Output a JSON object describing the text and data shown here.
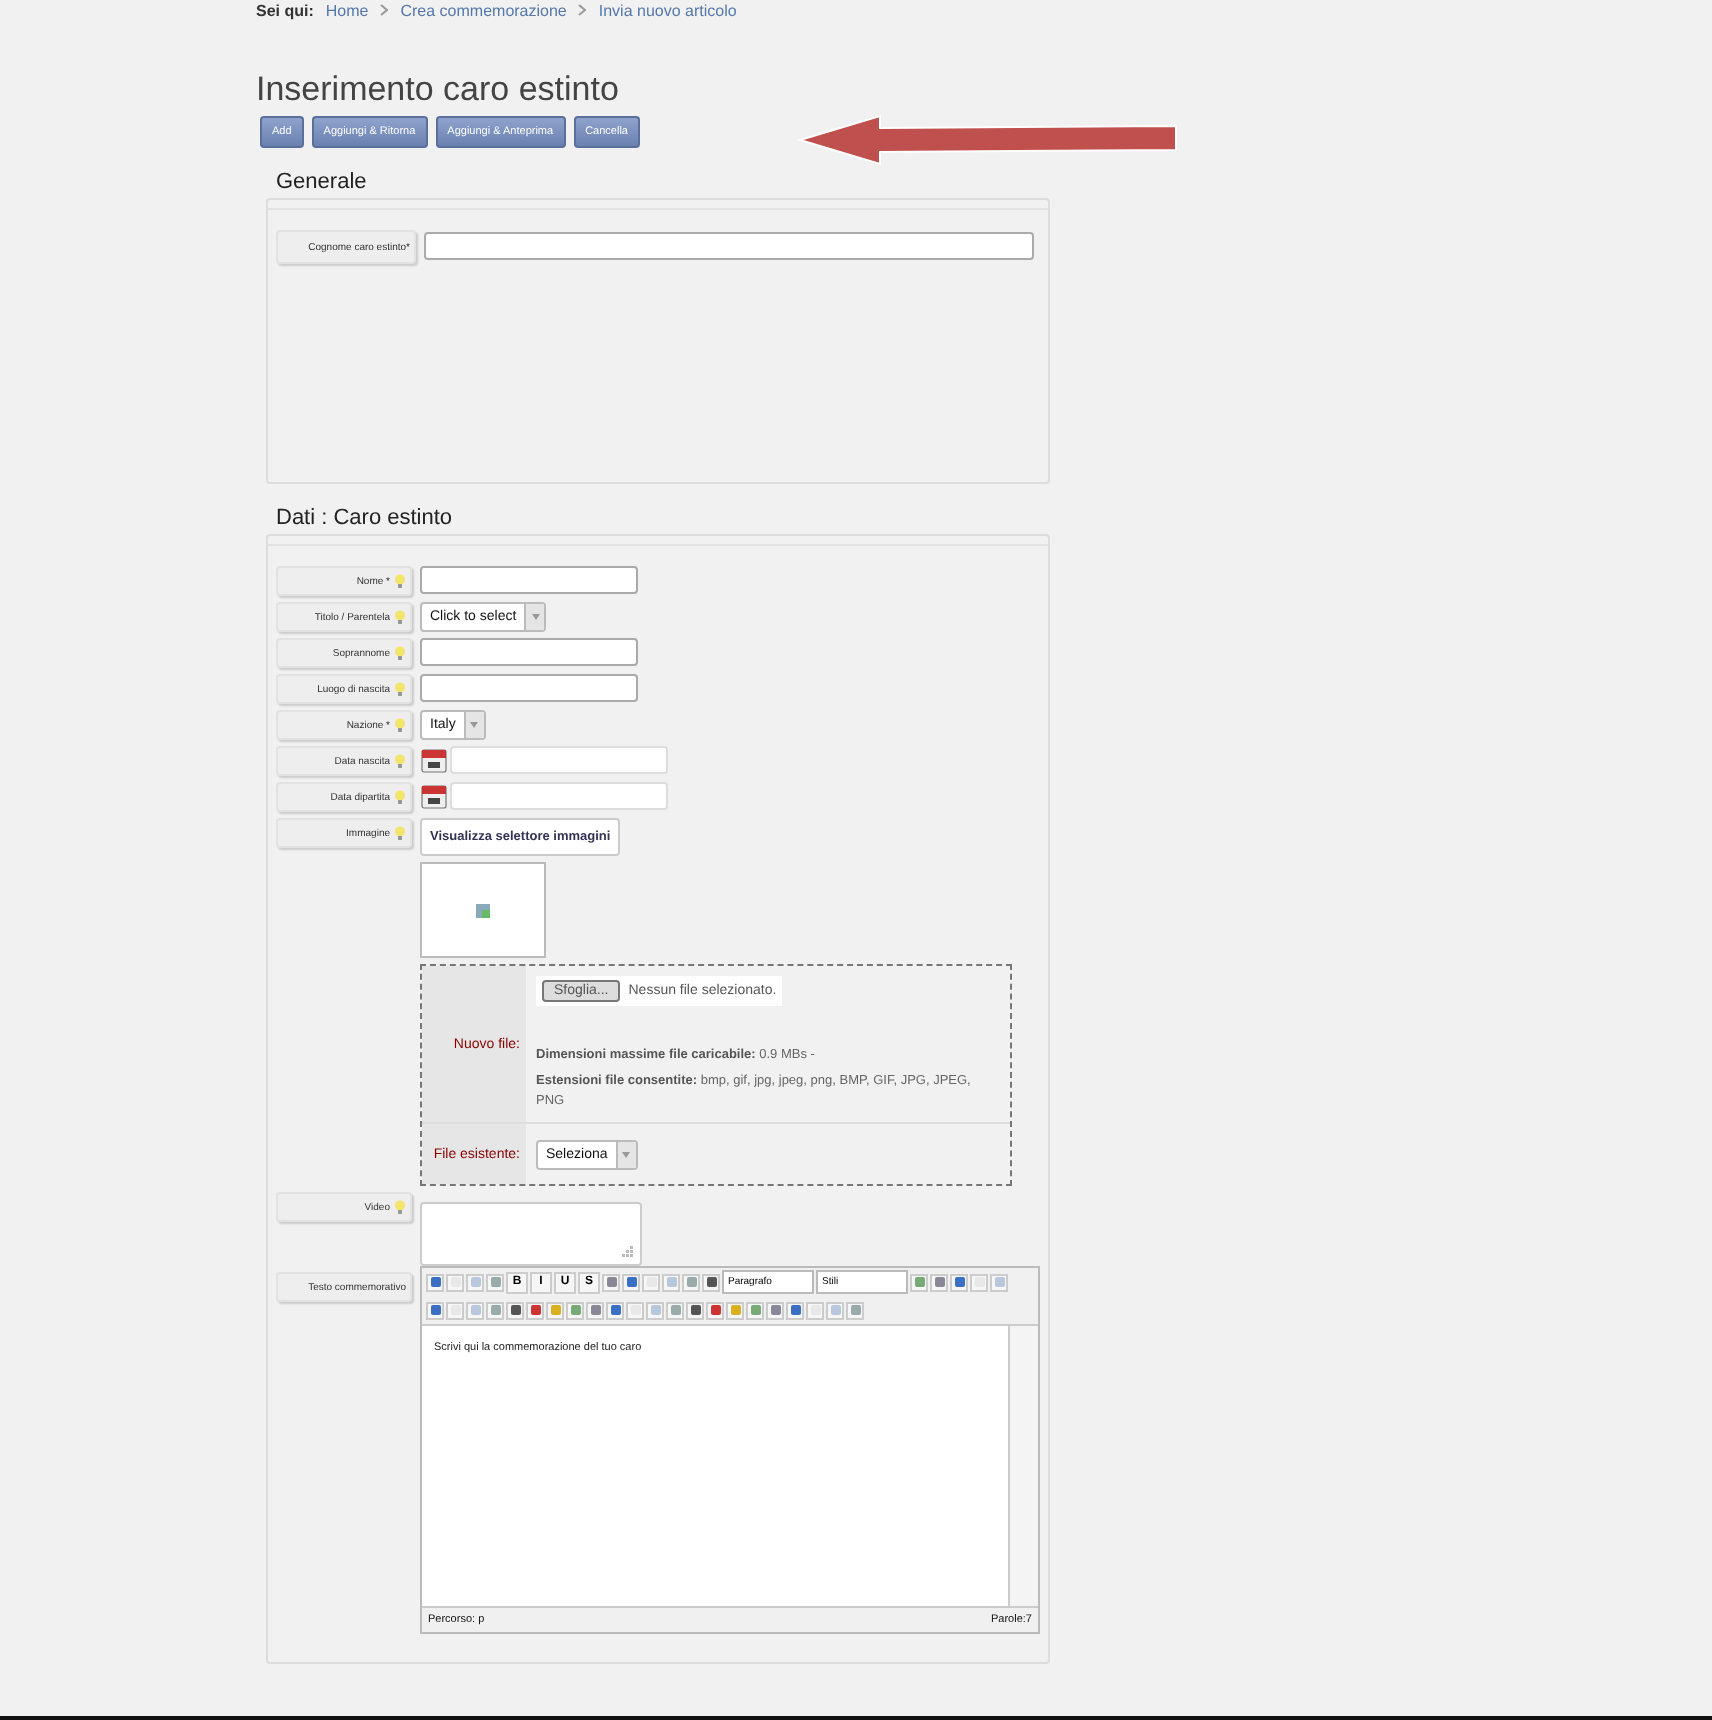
{
  "breadcrumb": {
    "label": "Sei qui:",
    "items": [
      "Home",
      "Crea commemorazione",
      "Invia nuovo articolo"
    ]
  },
  "title": "Inserimento caro estinto",
  "buttons": [
    "Add",
    "Aggiungi & Ritorna",
    "Aggiungi & Anteprima",
    "Cancella"
  ],
  "sections": [
    {
      "legend": "Generale",
      "fields": [
        {
          "kind": "wide",
          "label": "Cognome caro estinto*",
          "hint_icon": false
        }
      ]
    },
    {
      "legend": "Dati : Caro estinto",
      "fields": [
        {
          "kind": "text",
          "label": "Nome *",
          "hint_icon": true
        },
        {
          "kind": "select",
          "label": "Titolo / Parentela",
          "hint_icon": true,
          "value": "Click to select"
        },
        {
          "kind": "text",
          "label": "Soprannome",
          "hint_icon": true
        },
        {
          "kind": "text",
          "label": "Luogo di nascita",
          "hint_icon": true
        },
        {
          "kind": "select",
          "label": "Nazione *",
          "hint_icon": true,
          "value": "Italy"
        },
        {
          "kind": "date",
          "label": "Data nascita",
          "hint_icon": true
        },
        {
          "kind": "date",
          "label": "Data dipartita",
          "hint_icon": true
        },
        {
          "kind": "image",
          "label": "Immagine",
          "hint_icon": true,
          "button": "Visualizza selettore immagini",
          "upload": {
            "new_label": "Nuovo file:",
            "browse": "Sfoglia...",
            "no_file": "Nessun file selezionato.",
            "max_size": "**Dimensioni massime file caricabile:** 0.9 MBs  -",
            "extensions": "**Estensioni file consentite:** bmp, gif, jpg, jpeg, png, BMP, GIF, JPG, JPEG, PNG",
            "existing_label": "File esistente:",
            "existing_select": "Seleziona"
          }
        },
        {
          "kind": "textarea",
          "label": "Video",
          "hint_icon": true
        },
        {
          "kind": "editor",
          "label": "Testo commemorativo",
          "hint_icon": false,
          "toolbar": [
            [
              {
                "kind": "icon"
              },
              {
                "kind": "icon"
              },
              {
                "kind": "icon"
              },
              {
                "kind": "icon"
              },
              {
                "kind": "text",
                "label": "B"
              },
              {
                "kind": "text",
                "label": "I"
              },
              {
                "kind": "text",
                "label": "U"
              },
              {
                "kind": "text",
                "label": "S"
              },
              {
                "kind": "icon"
              },
              {
                "kind": "icon"
              },
              {
                "kind": "icon"
              },
              {
                "kind": "icon"
              },
              {
                "kind": "icon"
              },
              {
                "kind": "icon"
              },
              {
                "kind": "select",
                "label": "Paragrafo"
              },
              {
                "kind": "select",
                "label": "Stili"
              },
              {
                "kind": "icon"
              },
              {
                "kind": "icon"
              },
              {
                "kind": "icon"
              },
              {
                "kind": "icon"
              },
              {
                "kind": "icon"
              }
            ],
            [
              {
                "kind": "icon"
              },
              {
                "kind": "icon"
              },
              {
                "kind": "icon"
              },
              {
                "kind": "icon"
              },
              {
                "kind": "icon"
              },
              {
                "kind": "icon"
              },
              {
                "kind": "icon"
              },
              {
                "kind": "icon"
              },
              {
                "kind": "icon"
              },
              {
                "kind": "icon"
              },
              {
                "kind": "icon"
              },
              {
                "kind": "icon"
              },
              {
                "kind": "icon"
              },
              {
                "kind": "icon"
              },
              {
                "kind": "icon"
              },
              {
                "kind": "icon"
              },
              {
                "kind": "icon"
              },
              {
                "kind": "icon"
              },
              {
                "kind": "icon"
              },
              {
                "kind": "icon"
              },
              {
                "kind": "icon"
              },
              {
                "kind": "icon"
              }
            ]
          ],
          "content": "Scrivi qui la commemorazione del tuo caro",
          "path": "Percorso: p",
          "words": "Parole:7"
        }
      ]
    }
  ]
}
